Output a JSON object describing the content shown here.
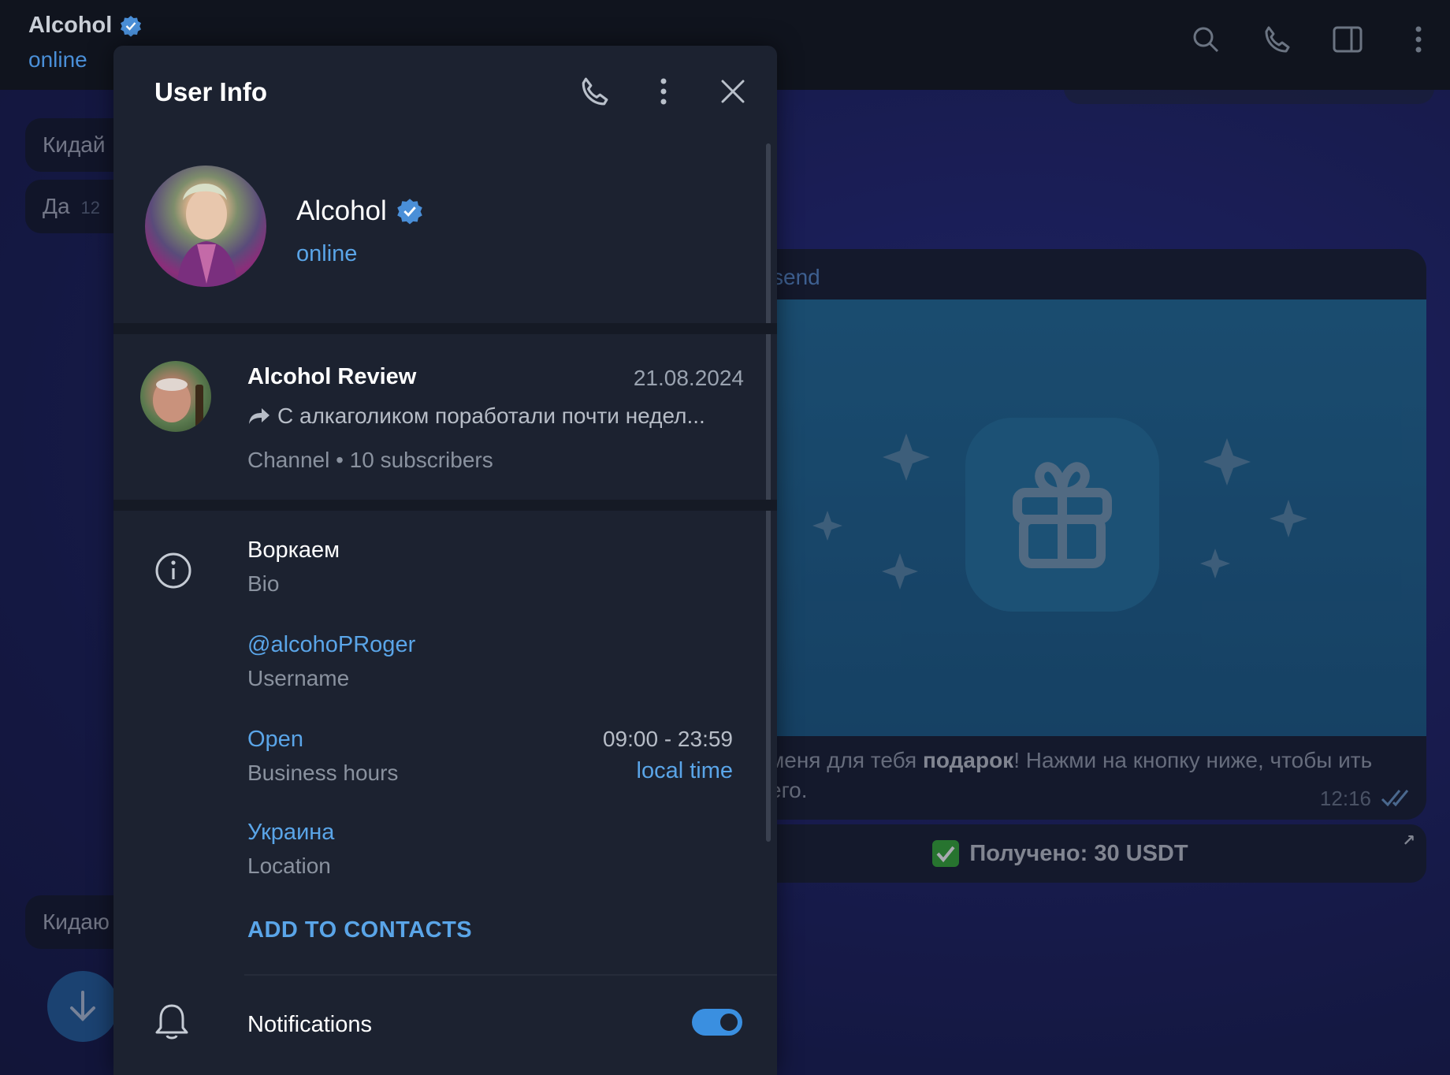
{
  "chat": {
    "title": "Alcohol",
    "status": "online",
    "messages": [
      {
        "text": "Кидай",
        "time": ""
      },
      {
        "text": "Да",
        "time": "12"
      },
      {
        "text": "Кидаю",
        "time": ""
      }
    ],
    "card_header": "send",
    "card_text": "меня для тебя подарок! Нажми на кнопку ниже, чтобы ить его.",
    "card_time": "12:16",
    "received_label": "Получено: 30 USDT"
  },
  "panel": {
    "title": "User Info",
    "profile": {
      "name": "Alcohol",
      "status": "online"
    },
    "channel": {
      "name": "Alcohol Review",
      "date": "21.08.2024",
      "message": "С алкаголиком поработали почти недел...",
      "meta": "Channel • 10 subscribers"
    },
    "bio": {
      "value": "Воркаем",
      "label": "Bio"
    },
    "username": {
      "value": "@alcohoPRoger",
      "label": "Username"
    },
    "business": {
      "value": "Open",
      "label": "Business hours",
      "hours": "09:00 - 23:59",
      "hours_label": "local time"
    },
    "location": {
      "value": "Украина",
      "label": "Location"
    },
    "add_contacts": "ADD TO CONTACTS",
    "notifications": {
      "label": "Notifications",
      "enabled": true
    }
  },
  "colors": {
    "accent": "#5aa5e8",
    "panel_bg": "#1c2230",
    "toggle_on": "#3a8fe0"
  }
}
